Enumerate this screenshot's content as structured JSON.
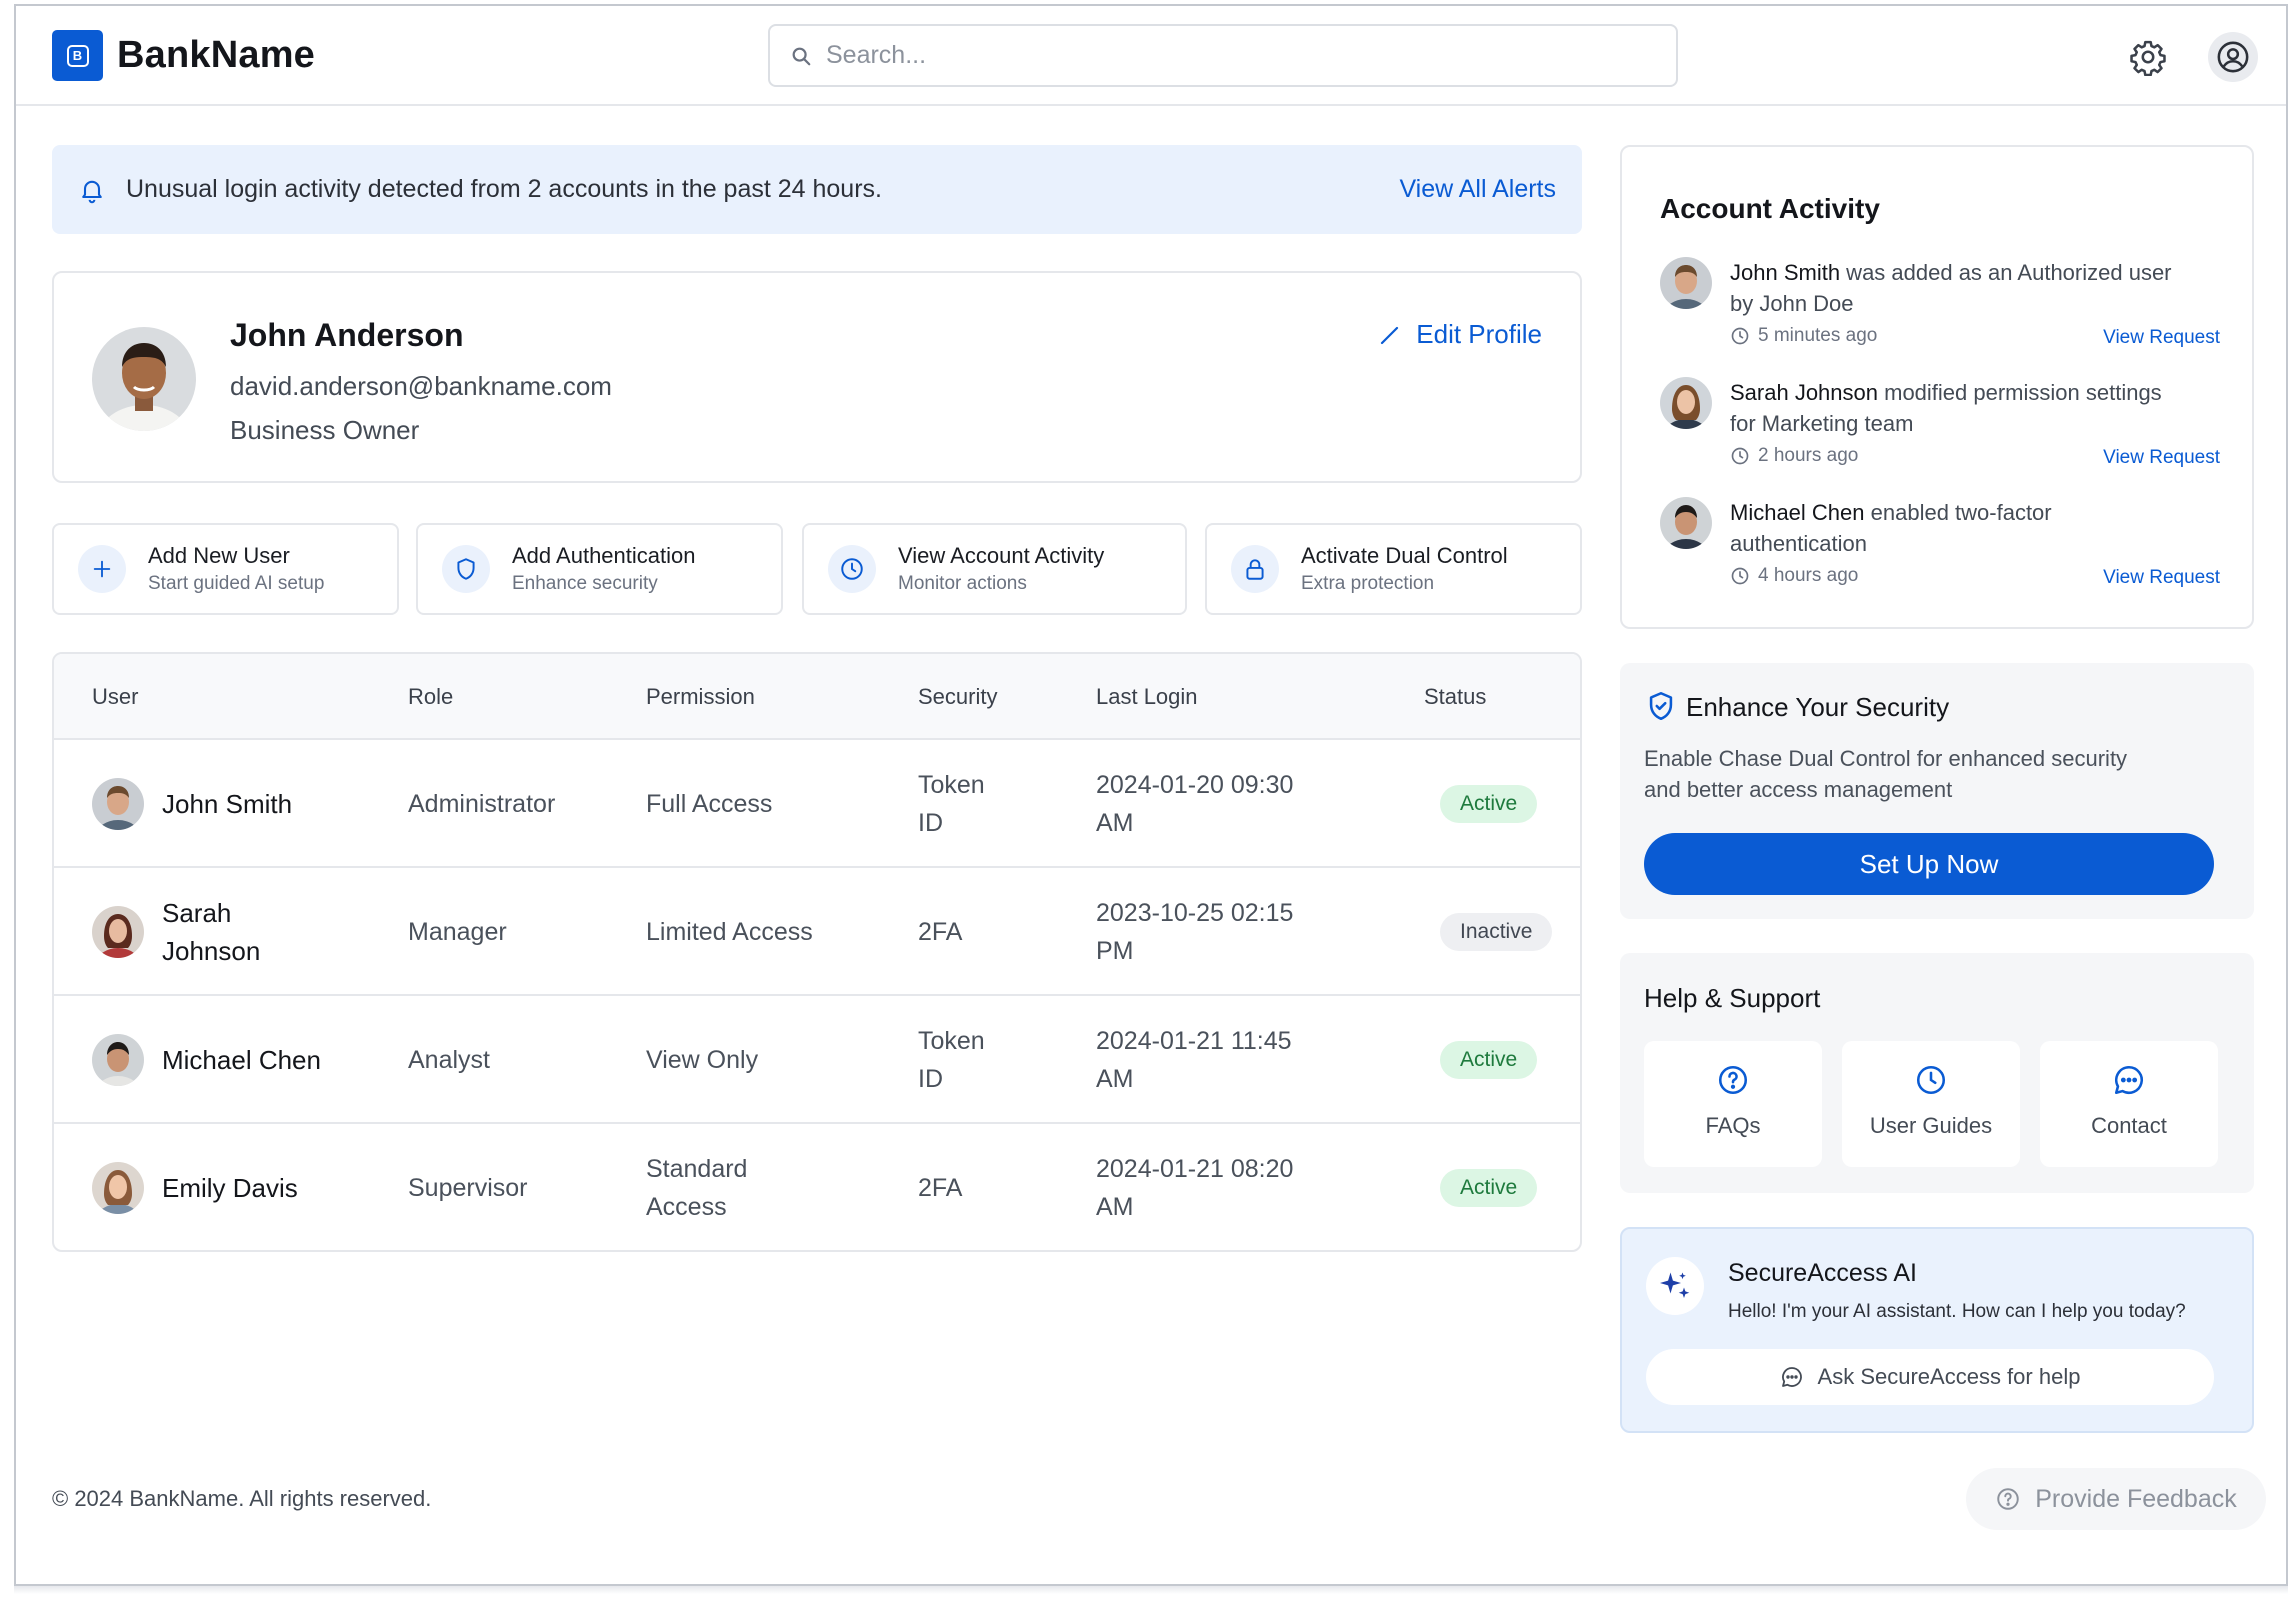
{
  "header": {
    "brand": "BankName",
    "logo_letter": "B",
    "search_placeholder": "Search..."
  },
  "alert": {
    "message": "Unusual login activity detected from 2 accounts in the past 24 hours.",
    "link": "View All Alerts"
  },
  "profile": {
    "name": "John Anderson",
    "email": "david.anderson@bankname.com",
    "role": "Business Owner",
    "edit_label": "Edit Profile"
  },
  "quick_actions": [
    {
      "title": "Add New User",
      "subtitle": "Start guided AI setup",
      "icon": "plus-icon"
    },
    {
      "title": "Add Authentication",
      "subtitle": "Enhance security",
      "icon": "shield-icon"
    },
    {
      "title": "View Account Activity",
      "subtitle": "Monitor actions",
      "icon": "clock-icon"
    },
    {
      "title": "Activate Dual Control",
      "subtitle": "Extra protection",
      "icon": "lock-icon"
    }
  ],
  "table": {
    "columns": [
      "User",
      "Role",
      "Permission",
      "Security",
      "Last Login",
      "Status"
    ],
    "rows": [
      {
        "user_line1": "John Smith",
        "user_line2": "",
        "role": "Administrator",
        "permission_line1": "Full Access",
        "permission_line2": "",
        "security_line1": "Token",
        "security_line2": "ID",
        "login_line1": "2024-01-20 09:30",
        "login_line2": "AM",
        "status": "Active"
      },
      {
        "user_line1": "Sarah",
        "user_line2": "Johnson",
        "role": "Manager",
        "permission_line1": "Limited Access",
        "permission_line2": "",
        "security_line1": "2FA",
        "security_line2": "",
        "login_line1": "2023-10-25 02:15",
        "login_line2": "PM",
        "status": "Inactive"
      },
      {
        "user_line1": "Michael Chen",
        "user_line2": "",
        "role": "Analyst",
        "permission_line1": "View Only",
        "permission_line2": "",
        "security_line1": "Token",
        "security_line2": "ID",
        "login_line1": "2024-01-21 11:45",
        "login_line2": "AM",
        "status": "Active"
      },
      {
        "user_line1": "Emily Davis",
        "user_line2": "",
        "role": "Supervisor",
        "permission_line1": "Standard",
        "permission_line2": "Access",
        "security_line1": "2FA",
        "security_line2": "",
        "login_line1": "2024-01-21 08:20",
        "login_line2": "AM",
        "status": "Active"
      }
    ]
  },
  "activity": {
    "title": "Account Activity",
    "items": [
      {
        "actor": "John Smith",
        "line1_rest": " was added as an Authorized user",
        "line2": "by John Doe",
        "time": "5 minutes ago",
        "link": "View Request"
      },
      {
        "actor": "Sarah Johnson",
        "line1_rest": " modified permission settings",
        "line2": "for Marketing team",
        "time": "2 hours ago",
        "link": "View Request"
      },
      {
        "actor": "Michael Chen",
        "line1_rest": " enabled two-factor",
        "line2": "authentication",
        "time": "4 hours ago",
        "link": "View Request"
      }
    ]
  },
  "security_card": {
    "title": "Enhance Your Security",
    "desc_line1": "Enable Chase Dual Control for enhanced security",
    "desc_line2": "and better access management",
    "button": "Set Up Now"
  },
  "help": {
    "title": "Help & Support",
    "tiles": [
      {
        "label": "FAQs",
        "icon": "question-circle-icon"
      },
      {
        "label": "User Guides",
        "icon": "clock-icon"
      },
      {
        "label": "Contact",
        "icon": "chat-icon"
      }
    ]
  },
  "ai": {
    "title": "SecureAccess AI",
    "subtitle": "Hello! I'm your AI assistant. How can I help you today?",
    "button": "Ask SecureAccess for help"
  },
  "footer": {
    "copyright": "© 2024 BankName. All rights reserved.",
    "feedback": "Provide Feedback"
  },
  "colors": {
    "accent": "#0a5bd3",
    "alert_bg": "#e9f1fd",
    "active_badge_bg": "#dcf6e4",
    "active_badge_text": "#1e7a3d",
    "inactive_badge_bg": "#eeeff2"
  }
}
